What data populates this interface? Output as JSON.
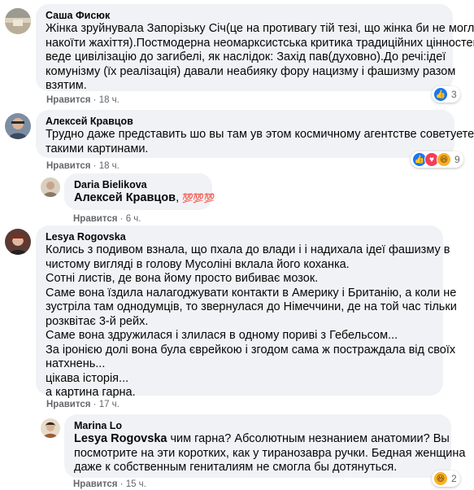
{
  "comments": [
    {
      "author": "Саша Фисюк",
      "lines": [
        "Жінка зруйнувала Запорізьку Січ(це на противагу тій тезі, що жінка би не могла",
        "накоїти жахіття).Постмодерна неомарксистська критика традиційних цінностей",
        "веде цивілізацію до загибелі, як наслідок: Захід пав(духовно).До речі:ідеї",
        "комунізму (їх реалізація) давали неабияку фору нацизму і фашизму разом",
        "взятим."
      ],
      "like_label": "Нравится",
      "time": "18 ч.",
      "reactions": {
        "icons": [
          "like-icon"
        ],
        "count": "3"
      }
    },
    {
      "author": "Алексей Кравцов",
      "lines": [
        "Трудно даже представить шо вы там ув этом космичному агентстве советуете, с",
        "такими картинами."
      ],
      "like_label": "Нравится",
      "time": "18 ч.",
      "reactions": {
        "icons": [
          "like-icon",
          "love-icon",
          "haha-icon"
        ],
        "count": "9"
      }
    },
    {
      "author": "Daria Bielikova",
      "mention": "Алексей Кравцов",
      "suffix": ",",
      "emoji": "💯💯💯",
      "like_label": "Нравится",
      "time": "6 ч."
    },
    {
      "author": "Lesya Rogovska",
      "lines": [
        "Колись з подивом взнала, що пхала до влади і і надихала ідеї фашизму в",
        "чистому вигляді в голову Мусоліні вклала його коханка.",
        "Сотні листів, де вона йому просто вибиває мозок.",
        "Саме вона їздила налагоджувати контакти в Америку і Британію, а коли не",
        "зустріла там однодумців, то звернулася до Німеччини, де на той час тільки",
        "розквітає 3-й рейх.",
        "Саме вона здружилася і злилася в одному пориві з Гебельсом...",
        "За іронією долі вона була єврейкою і згодом сама ж постраждала від своїх",
        "натхнень...",
        "цікава історія...",
        "а картина гарна."
      ],
      "like_label": "Нравится",
      "time": "17 ч."
    },
    {
      "author": "Marina Lo",
      "mention": "Lesya Rogovska",
      "lines": [
        " чим гарна? Абсолютным незнанием анатомии? Вы",
        "посмотрите на эти коротких, как у тиранозавра ручки. Бедная женщина",
        "даже к собственным гениталиям не смогла бы дотянуться."
      ],
      "like_label": "Нравится",
      "time": "15 ч.",
      "reactions": {
        "icons": [
          "haha-icon"
        ],
        "count": "2"
      }
    }
  ],
  "colors": {
    "bubble": "#f0f2f5",
    "meta_text": "#65676b",
    "like_blue": "#1877f2",
    "love_red": "#f33e58",
    "haha_yellow": "#f7b125"
  }
}
